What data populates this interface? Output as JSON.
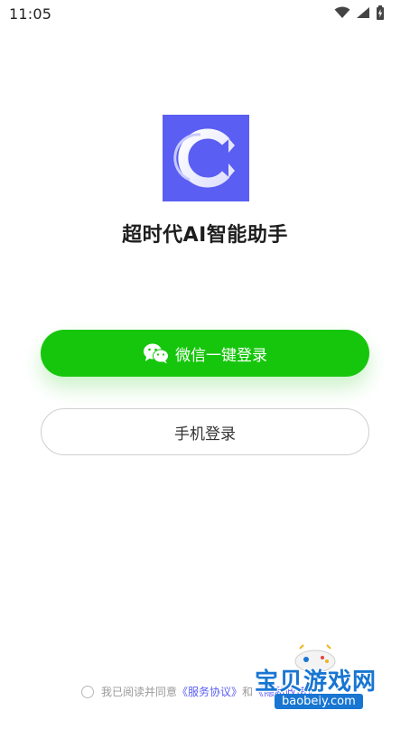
{
  "status_bar": {
    "time": "11:05",
    "icons": [
      "wifi-icon",
      "signal-icon",
      "battery-icon"
    ]
  },
  "app": {
    "logo_letter": "C",
    "title": "超时代AI智能助手",
    "brand_color": "#5a5ef2"
  },
  "buttons": {
    "wechat_login": "微信一键登录",
    "phone_login": "手机登录",
    "wechat_color": "#16c60c"
  },
  "agreement": {
    "prefix": "我已阅读并同意",
    "service": "《服务协议》",
    "and": "和",
    "privacy": "《隐私政策》"
  },
  "watermark": {
    "title": "宝贝游戏网",
    "domain": "baobeiy.com"
  }
}
